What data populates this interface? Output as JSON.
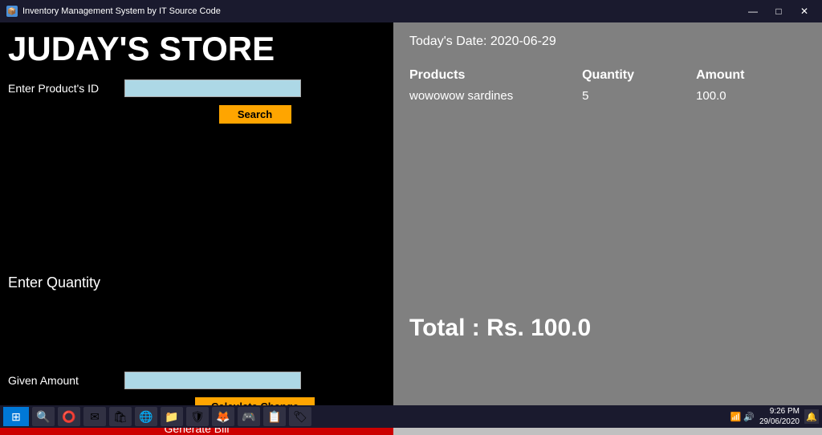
{
  "titlebar": {
    "title": "Inventory Management System by IT Source Code",
    "icon": "📦",
    "minimize": "—",
    "maximize": "□",
    "close": "✕"
  },
  "left": {
    "store_title": "JUDAY'S STORE",
    "product_id_label": "Enter Product's ID",
    "product_id_value": "",
    "product_id_placeholder": "",
    "search_button": "Search",
    "quantity_label": "Enter Quantity",
    "given_amount_label": "Given Amount",
    "given_amount_value": "",
    "calculate_button": "Calculate Change",
    "generate_bill_button": "Generate Bill"
  },
  "right": {
    "today_date": "Today's Date: 2020-06-29",
    "table_headers": [
      "Products",
      "Quantity",
      "Amount"
    ],
    "table_rows": [
      {
        "product": "wowowow sardines",
        "quantity": "5",
        "amount": "100.0"
      }
    ],
    "total_label": "Total : Rs. 100.0"
  },
  "taskbar": {
    "time": "9:26 PM",
    "date": "29/06/2020",
    "icons": [
      "🔍",
      "✉",
      "🏪",
      "🌐",
      "📁",
      "🛡",
      "🦊",
      "🎮",
      "📋",
      "🏷"
    ],
    "sys_icons": "⌂ 📶 🔊"
  }
}
